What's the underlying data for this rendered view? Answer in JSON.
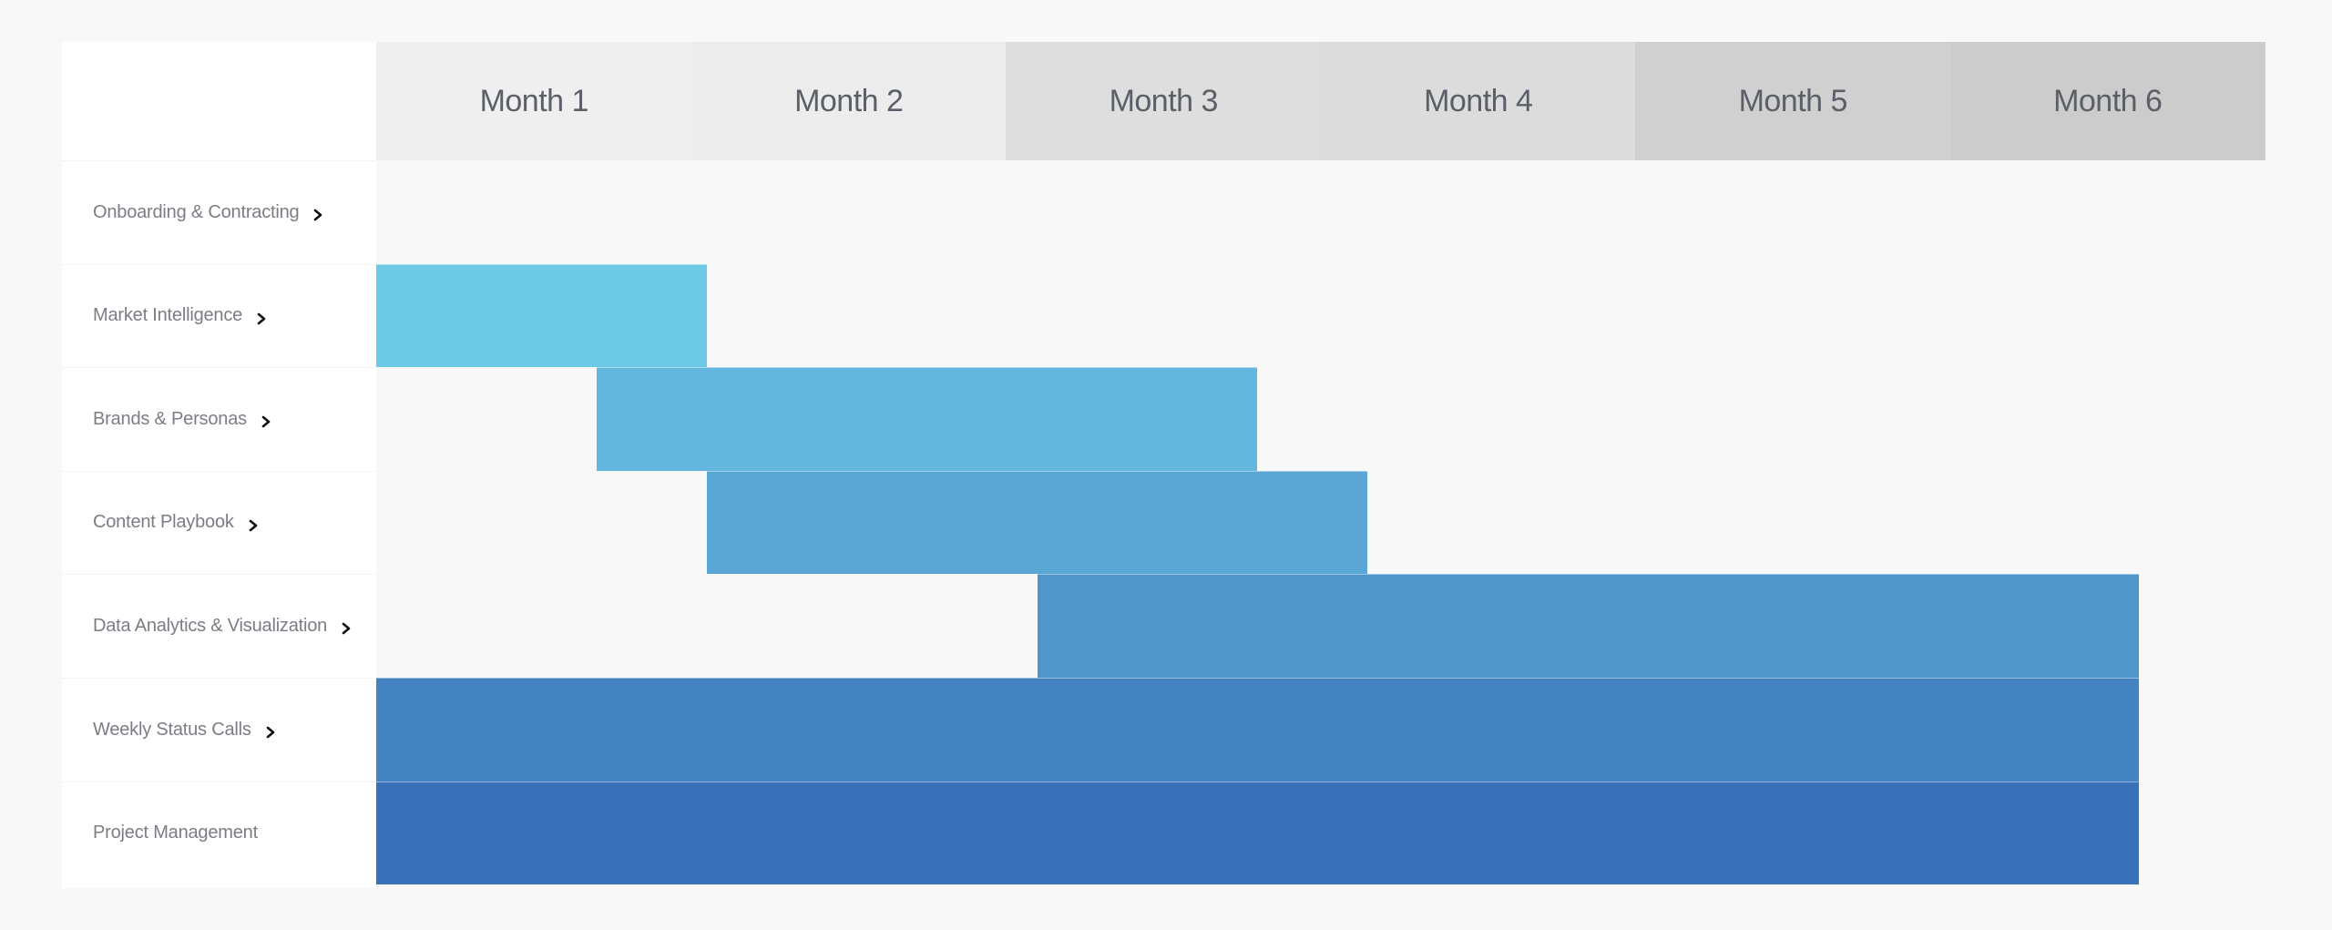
{
  "chart_data": {
    "type": "gantt",
    "title": "",
    "xlabel": "",
    "ylabel": "",
    "x_unit": "months",
    "xlim": [
      0,
      6
    ],
    "categories": [
      "Month 1",
      "Month 2",
      "Month 3",
      "Month 4",
      "Month 5",
      "Month 6"
    ],
    "header_colors": [
      "#efefef",
      "#ececec",
      "#dedede",
      "#dcdcdc",
      "#d0d0d0",
      "#cccccc"
    ],
    "tasks": [
      {
        "name": "Onboarding & Contracting",
        "expandable": true,
        "start": null,
        "end": null,
        "color": null
      },
      {
        "name": "Market Intelligence",
        "expandable": true,
        "start": 0,
        "end": 1.05,
        "color": "#6dcae6"
      },
      {
        "name": "Brands & Personas",
        "expandable": true,
        "start": 0.7,
        "end": 2.8,
        "color": "#63b7df"
      },
      {
        "name": "Content Playbook",
        "expandable": true,
        "start": 1.05,
        "end": 3.15,
        "color": "#5aa7d5"
      },
      {
        "name": "Data Analytics & Visualization",
        "expandable": true,
        "start": 2.1,
        "end": 5.6,
        "color": "#4f96cb"
      },
      {
        "name": "Weekly Status Calls",
        "expandable": true,
        "start": 0,
        "end": 5.6,
        "color": "#4483c1"
      },
      {
        "name": "Project Management",
        "expandable": false,
        "start": 0,
        "end": 5.6,
        "color": "#3871b7"
      }
    ],
    "grid": false
  },
  "icons": {
    "expand": "chevron-right-icon"
  }
}
